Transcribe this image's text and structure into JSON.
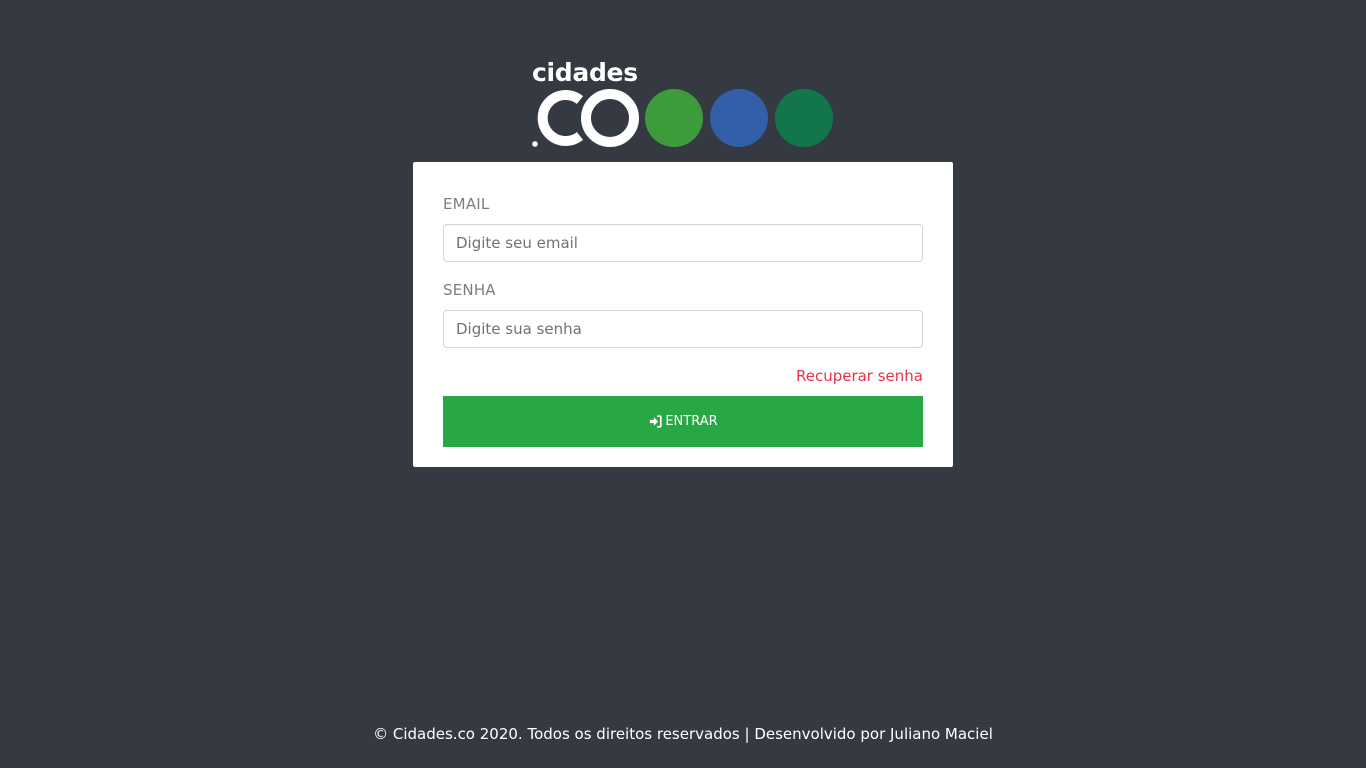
{
  "logo": {
    "word": "cidades",
    "mark": ".co",
    "colors": {
      "text": "#ffffff",
      "dot_1": "#3c9c3b",
      "dot_2": "#335ea8",
      "dot_3": "#12764a"
    }
  },
  "form": {
    "email": {
      "label": "EMAIL",
      "placeholder": "Digite seu email",
      "value": ""
    },
    "password": {
      "label": "SENHA",
      "placeholder": "Digite sua senha",
      "value": ""
    },
    "recover_link": "Recuperar senha",
    "submit": {
      "label": "ENTRAR",
      "icon": "sign-in-icon"
    }
  },
  "footer": {
    "text": "© Cidades.co 2020. Todos os direitos reservados | Desenvolvido por Juliano Maciel"
  },
  "theme": {
    "background": "#353941",
    "card": "#ffffff",
    "primary_button": "#28a745",
    "link": "#e8334a",
    "label": "#7a7f86"
  }
}
